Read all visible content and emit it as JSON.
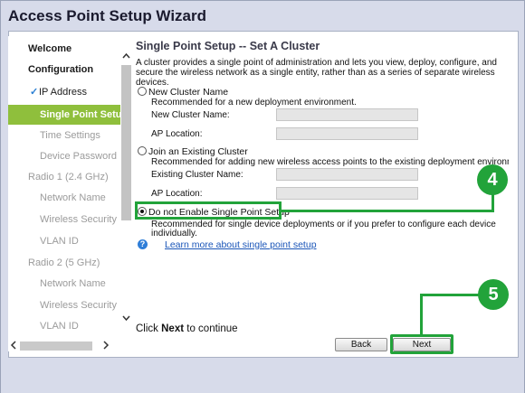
{
  "window": {
    "title": "Access Point Setup Wizard"
  },
  "sidebar": {
    "welcome": "Welcome",
    "configuration": "Configuration",
    "ip_address": "IP Address",
    "single_point_setup": "Single Point Setup",
    "time_settings": "Time Settings",
    "device_password": "Device Password",
    "radio1": "Radio 1 (2.4 GHz)",
    "radio1_network_name": "Network Name",
    "radio1_wireless_security": "Wireless Security",
    "radio1_vlan_id": "VLAN ID",
    "radio2": "Radio 2 (5 GHz)",
    "radio2_network_name": "Network Name",
    "radio2_wireless_security": "Wireless Security",
    "radio2_vlan_id": "VLAN ID",
    "checkmark": "✓"
  },
  "main": {
    "heading": "Single Point Setup -- Set A Cluster",
    "description": "A cluster provides a single point of administration and lets you view, deploy, configure, and secure the wireless network as a single entity, rather than as a series of separate wireless devices.",
    "option_new": {
      "label": "New Cluster Name",
      "subtext": "Recommended for a new deployment environment.",
      "name_label": "New Cluster Name:",
      "name_value": "",
      "ap_label": "AP Location:",
      "ap_value": "",
      "selected": false
    },
    "option_join": {
      "label": "Join an Existing Cluster",
      "subtext": "Recommended for adding new wireless access points to the existing deployment environment.",
      "name_label": "Existing Cluster Name:",
      "name_value": "",
      "ap_label": "AP Location:",
      "ap_value": "",
      "selected": false
    },
    "option_disable": {
      "label": "Do not Enable Single Point Setup",
      "subtext_1": "Recommended for single device deployments or if you prefer to configure each device",
      "subtext_2": "individually.",
      "selected": true
    },
    "help_icon": "?",
    "learn_more": "Learn more about single point setup",
    "continue_prefix": "Click ",
    "continue_bold": "Next",
    "continue_suffix": " to continue"
  },
  "buttons": {
    "back": "Back",
    "next": "Next"
  },
  "callouts": {
    "step4": "4",
    "step5": "5"
  },
  "colors": {
    "accent_green": "#22a33a",
    "active_item": "#8fbf3c",
    "link": "#1a55b8"
  }
}
